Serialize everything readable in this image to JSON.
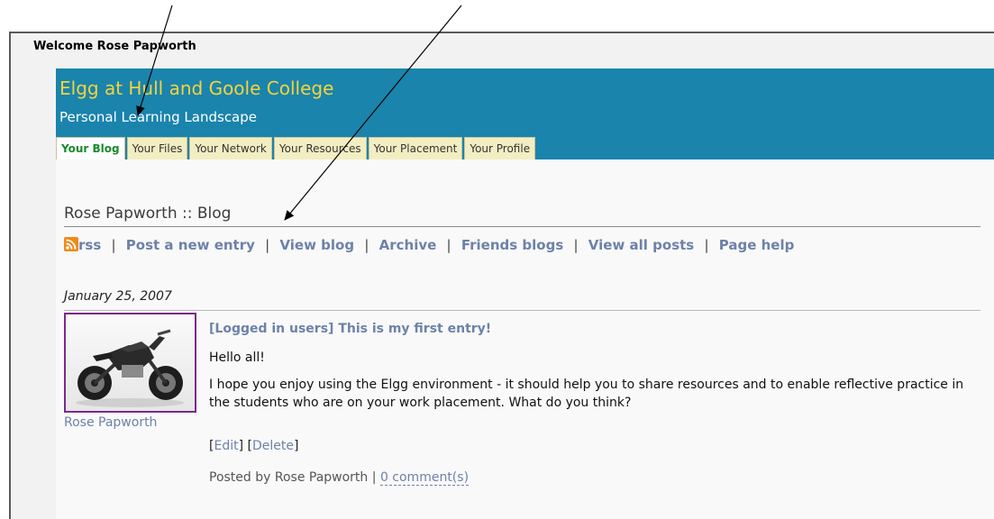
{
  "welcome": "Welcome Rose Papworth",
  "header": {
    "title": "Elgg at Hull and Goole College",
    "subtitle": "Personal Learning Landscape"
  },
  "tabs": [
    {
      "label": "Your Blog",
      "active": true
    },
    {
      "label": "Your Files"
    },
    {
      "label": "Your Network"
    },
    {
      "label": "Your Resources"
    },
    {
      "label": "Your Placement"
    },
    {
      "label": "Your Profile"
    }
  ],
  "blog": {
    "heading": "Rose Papworth :: Blog",
    "nav": {
      "rss": "rss",
      "post_new": "Post a new entry",
      "view_blog": "View blog",
      "archive": "Archive",
      "friends_blogs": "Friends blogs",
      "view_all": "View all posts",
      "help": "Page help",
      "separator": "|"
    }
  },
  "post": {
    "date": "January 25, 2007",
    "title": "[Logged in users] This is my first entry!",
    "author": "Rose Papworth",
    "paragraphs": [
      "Hello all!",
      "I hope you enjoy using the Elgg environment - it should help you to share resources and to enable reflective practice in the students who are on your work placement. What do you think?"
    ],
    "edit": "Edit",
    "delete": "Delete",
    "posted_by": "Posted by Rose Papworth",
    "comments": "0 comment(s)"
  },
  "colors": {
    "header_bg": "#1a84ad",
    "title_yellow": "#f5d33b",
    "link_blue": "#6d82a8",
    "avatar_border": "#7a2a8a"
  }
}
